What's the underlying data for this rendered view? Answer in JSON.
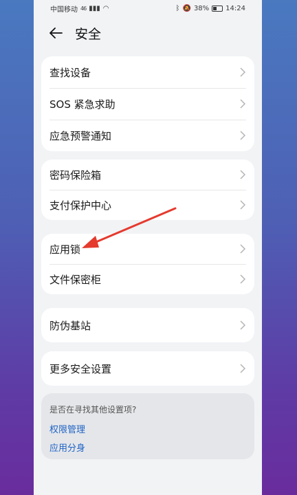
{
  "status_bar": {
    "carrier": "中国移动",
    "signal": "46",
    "battery": "38%",
    "time": "14:24"
  },
  "header": {
    "title": "安全"
  },
  "groups": [
    {
      "items": [
        "查找设备",
        "SOS 紧急求助",
        "应急预警通知"
      ]
    },
    {
      "items": [
        "密码保险箱",
        "支付保护中心"
      ]
    },
    {
      "items": [
        "应用锁",
        "文件保密柜"
      ]
    },
    {
      "items": [
        "防伪基站"
      ]
    },
    {
      "items": [
        "更多安全设置"
      ]
    }
  ],
  "suggestions": {
    "question": "是否在寻找其他设置项?",
    "links": [
      "权限管理",
      "应用分身"
    ]
  },
  "colors": {
    "link": "#1f63c6",
    "annotation_arrow": "#e53a2e"
  }
}
